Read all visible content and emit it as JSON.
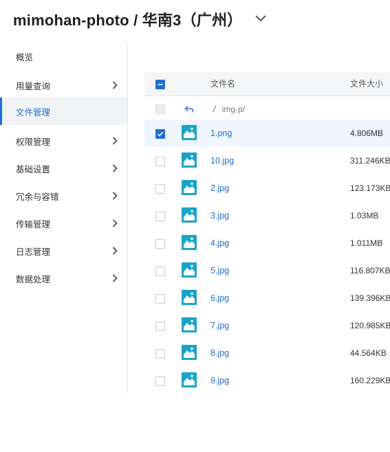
{
  "header": {
    "title": "mimohan-photo / 华南3（广州）",
    "chevron_icon": "chevron-down-icon"
  },
  "sidebar": {
    "items": [
      {
        "label": "概览",
        "has_chevron": false,
        "active": false
      },
      {
        "label": "用量查询",
        "has_chevron": true,
        "active": false
      },
      {
        "label": "文件管理",
        "has_chevron": false,
        "active": true
      },
      {
        "label": "权限管理",
        "has_chevron": true,
        "active": false
      },
      {
        "label": "基础设置",
        "has_chevron": true,
        "active": false
      },
      {
        "label": "冗余与容错",
        "has_chevron": true,
        "active": false
      },
      {
        "label": "传输管理",
        "has_chevron": true,
        "active": false
      },
      {
        "label": "日志管理",
        "has_chevron": true,
        "active": false
      },
      {
        "label": "数据处理",
        "has_chevron": true,
        "active": false
      }
    ]
  },
  "table": {
    "header": {
      "col_name": "文件名",
      "col_size": "文件大小",
      "select_all": "partial"
    },
    "path_row": {
      "prefix": "/",
      "path": "img-p/",
      "back_icon": "back-arrow-icon"
    },
    "rows": [
      {
        "name": "1.png",
        "size": "4.806MB",
        "selected": true
      },
      {
        "name": "10.jpg",
        "size": "311.246KB",
        "selected": false
      },
      {
        "name": "2.jpg",
        "size": "123.173KB",
        "selected": false
      },
      {
        "name": "3.jpg",
        "size": "1.03MB",
        "selected": false
      },
      {
        "name": "4.jpg",
        "size": "1.011MB",
        "selected": false
      },
      {
        "name": "5.jpg",
        "size": "116.807KB",
        "selected": false
      },
      {
        "name": "6.jpg",
        "size": "139.396KB",
        "selected": false
      },
      {
        "name": "7.jpg",
        "size": "120.985KB",
        "selected": false
      },
      {
        "name": "8.jpg",
        "size": "44.564KB",
        "selected": false
      },
      {
        "name": "9.jpg",
        "size": "160.229KB",
        "selected": false
      }
    ]
  },
  "colors": {
    "accent": "#1f6fd1",
    "thumb": "#1aa3c9"
  }
}
